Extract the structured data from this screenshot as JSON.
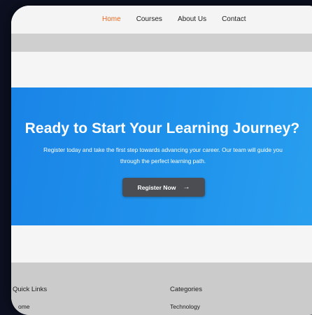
{
  "nav": {
    "links": [
      "Home",
      "Courses",
      "About Us",
      "Contact"
    ]
  },
  "hero": {
    "title": "Ready to Start Your Learning Journey?",
    "description_line1": "Register today and take the first step towards advancing your career. Our team will guide you",
    "description_line2": "through the perfect learning path.",
    "cta_label": "Register Now",
    "cta_icon": "arrow-right-icon"
  },
  "footer": {
    "quick_links_heading": "Quick Links",
    "quick_links_item": "ome",
    "categories_heading": "Categories",
    "categories_item": "Technology"
  },
  "colors": {
    "accent": "#e86a1e",
    "hero_blue": "#1f8fea",
    "button": "#4b4d52"
  }
}
